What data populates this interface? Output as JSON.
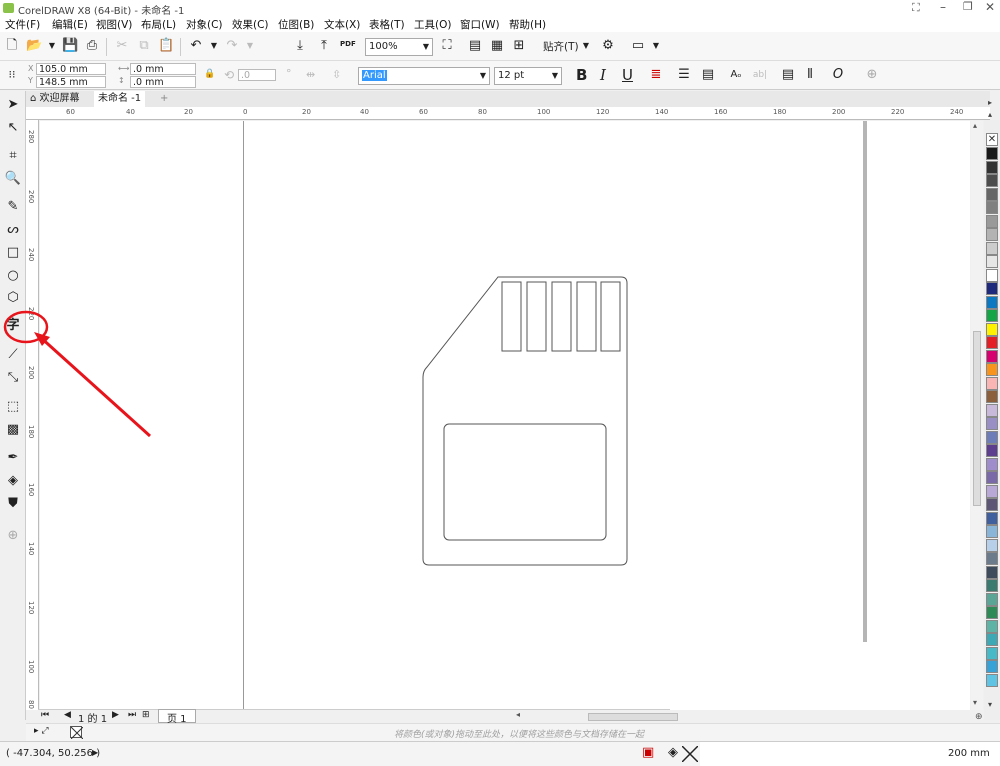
{
  "title": "CorelDRAW X8 (64-Bit) - 未命名 -1",
  "menu": [
    "文件(F)",
    "编辑(E)",
    "视图(V)",
    "布局(L)",
    "对象(C)",
    "效果(C)",
    "位图(B)",
    "文本(X)",
    "表格(T)",
    "工具(O)",
    "窗口(W)",
    "帮助(H)"
  ],
  "toolbar": {
    "zoom": "100%",
    "snap": "贴齐(T)",
    "pdf": "PDF"
  },
  "propbar": {
    "x": "105.0 mm",
    "y": "148.5 mm",
    "w": ".0 mm",
    "h": ".0 mm",
    "angle": ".0",
    "font": "Arial",
    "size": "12 pt",
    "bold": "B",
    "italic": "I",
    "underline": "U"
  },
  "tabs": {
    "welcome": "欢迎屏幕",
    "doc": "未命名 -1"
  },
  "hruler": [
    "60",
    "40",
    "20",
    "0",
    "20",
    "40",
    "60",
    "80",
    "100",
    "120",
    "140",
    "160",
    "180",
    "200",
    "220",
    "240"
  ],
  "vruler": [
    "280",
    "260",
    "240",
    "220",
    "200",
    "180",
    "160",
    "140",
    "120",
    "100",
    "80",
    "60"
  ],
  "page_nav": {
    "page_of": "1 的 1",
    "page_tab": "页 1"
  },
  "status": {
    "hint": "将颜色(或对象)拖动至此处，以便将这些颜色与文档存储在一起",
    "coords": "( -47.304, 50.256 )",
    "size_right": "200 mm"
  },
  "text_tool_glyph": "字",
  "annotation_color": "#e8141b",
  "palette": [
    "#ffffff",
    "#1a1a1a",
    "#333333",
    "#4d4d4d",
    "#666666",
    "#808080",
    "#999999",
    "#b3b3b3",
    "#cccccc",
    "#e6e6e6",
    "#ffffff",
    "#1f2a7d",
    "#0b78c1",
    "#15a546",
    "#fff200",
    "#e31e24",
    "#d6006f",
    "#f7941d",
    "#f9b4b4",
    "#8b5e3c",
    "#c8b9db",
    "#9a8fc5",
    "#6c7db8",
    "#5c3d8e",
    "#9f8ccb",
    "#7a6aa8",
    "#b9a9d6",
    "#5d5675",
    "#3f5f9d",
    "#89b5d9",
    "#b7cfe8",
    "#6c7b8b",
    "#3d4b5c",
    "#3b7a6e",
    "#5aa596",
    "#2e8b57",
    "#5fb3a6",
    "#3fa8b5",
    "#48b9c7",
    "#38a1d6",
    "#5fc4e4"
  ]
}
